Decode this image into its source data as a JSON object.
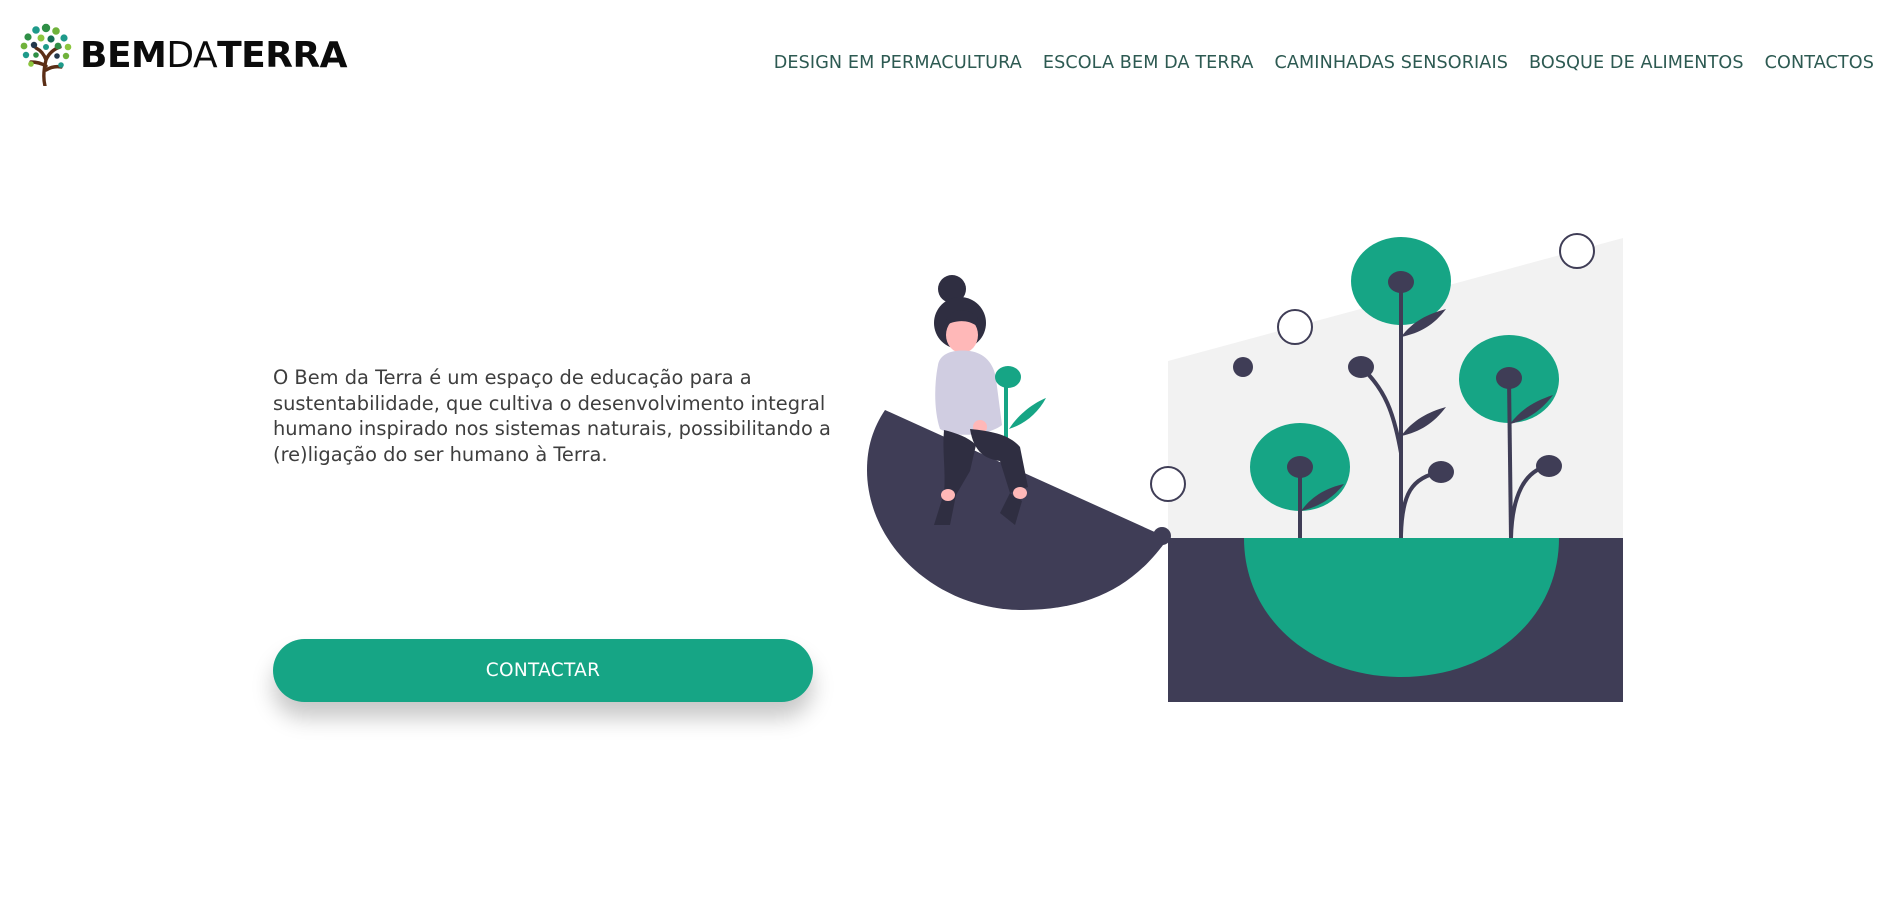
{
  "header": {
    "logo": {
      "bold_part_1": "BEM",
      "light_part": "DA",
      "bold_part_2": "TERRA"
    },
    "nav": [
      {
        "label": "DESIGN EM PERMACULTURA"
      },
      {
        "label": "ESCOLA BEM DA TERRA"
      },
      {
        "label": "CAMINHADAS SENSORIAIS"
      },
      {
        "label": "BOSQUE DE ALIMENTOS"
      },
      {
        "label": "CONTACTOS"
      }
    ]
  },
  "hero": {
    "description": "O Bem da Terra é um espaço de educação para a sustentabilidade, que cultiva o desenvolvimento integral humano inspirado nos sistemas naturais, possibilitando a (re)ligação do ser humano à Terra.",
    "cta_label": "CONTACTAR"
  },
  "colors": {
    "accent": "#16a585",
    "nav_text": "#2d5a52",
    "dark": "#3f3d56",
    "light_gray": "#f2f2f2",
    "body_text": "#3e3e3e"
  },
  "icons": {
    "logo": "tree-icon",
    "illustration": "woman-sitting-with-plants-illustration"
  }
}
